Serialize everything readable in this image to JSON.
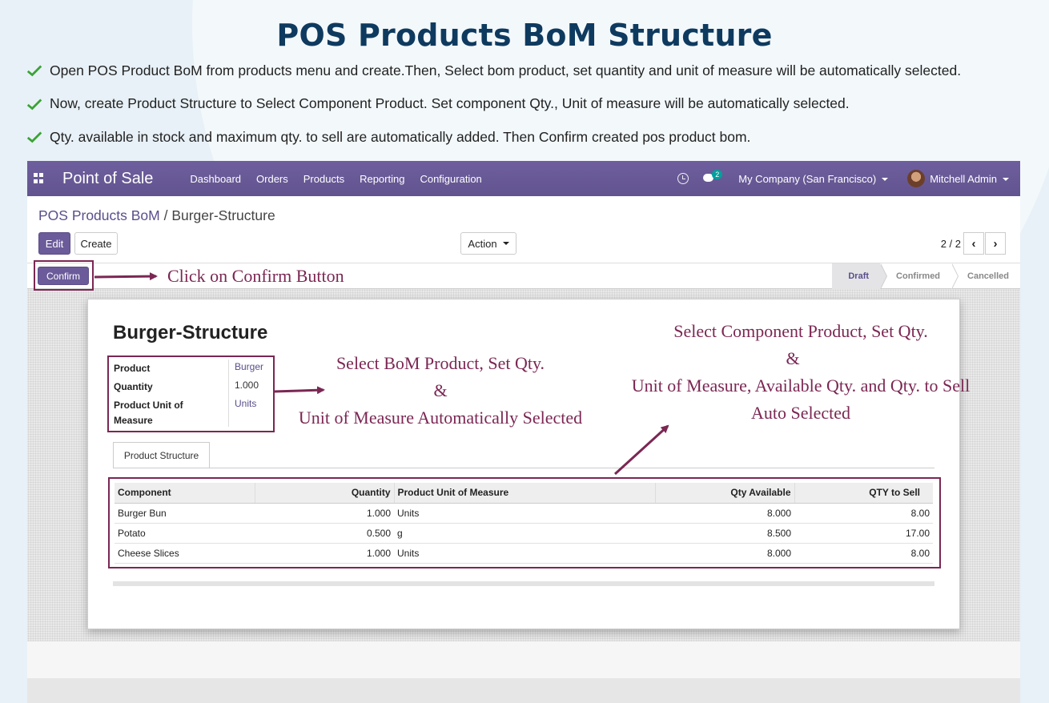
{
  "heading": "POS Products BoM Structure",
  "bullets": [
    "Open POS Product BoM from products menu and create.Then, Select bom product, set quantity and unit of measure will be automatically selected.",
    "Now, create Product Structure to Select Component Product. Set component Qty., Unit of measure will be automatically selected.",
    "Qty. available in stock and maximum qty. to sell are automatically added. Then Confirm created pos product bom."
  ],
  "navbar": {
    "brand": "Point of Sale",
    "menu": [
      "Dashboard",
      "Orders",
      "Products",
      "Reporting",
      "Configuration"
    ],
    "messages_badge": "2",
    "company": "My Company (San Francisco)",
    "user": "Mitchell Admin"
  },
  "control_panel": {
    "breadcrumb_root": "POS Products BoM",
    "breadcrumb_sep": " / ",
    "breadcrumb_current": "Burger-Structure",
    "edit_label": "Edit",
    "create_label": "Create",
    "action_label": "Action",
    "pager": "2 / 2",
    "prev": "‹",
    "next": "›"
  },
  "statusbar": {
    "confirm_label": "Confirm",
    "stages": [
      "Draft",
      "Confirmed",
      "Cancelled"
    ],
    "active_stage": "Draft"
  },
  "record": {
    "title": "Burger-Structure",
    "fields": {
      "product_label": "Product",
      "product_value": "Burger",
      "quantity_label": "Quantity",
      "quantity_value": "1.000",
      "uom_label": "Product Unit of Measure",
      "uom_value": "Units"
    },
    "tab_label": "Product Structure",
    "table": {
      "headers": [
        "Component",
        "Quantity",
        "Product Unit of Measure",
        "Qty Available",
        "QTY to Sell"
      ],
      "rows": [
        [
          "Burger Bun",
          "1.000",
          "Units",
          "8.000",
          "8.00"
        ],
        [
          "Potato",
          "0.500",
          "g",
          "8.500",
          "17.00"
        ],
        [
          "Cheese Slices",
          "1.000",
          "Units",
          "8.000",
          "8.00"
        ]
      ]
    }
  },
  "annotations": {
    "confirm": "Click on Confirm Button",
    "bom_line1": "Select BoM Product, Set Qty.",
    "bom_line2": "&",
    "bom_line3": "Unit of Measure Automatically Selected",
    "comp_line1": "Select Component Product, Set Qty.",
    "comp_line2": "&",
    "comp_line3": "Unit of Measure, Available Qty. and Qty. to Sell",
    "comp_line4": "Auto Selected"
  },
  "colors": {
    "heading": "#0e3a5f",
    "check": "#3aa335",
    "navbar": "#6b5b9a",
    "annotation": "#7b2753"
  }
}
